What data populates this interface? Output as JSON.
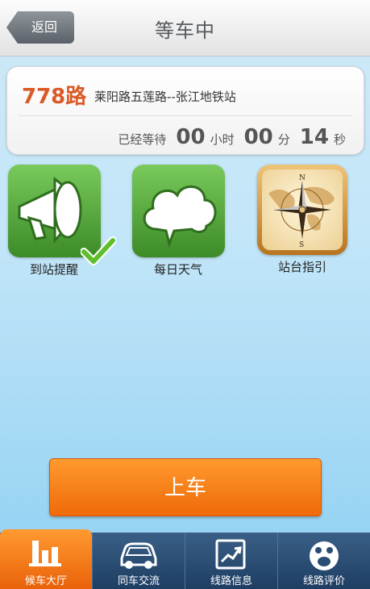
{
  "header": {
    "back_label": "返回",
    "title": "等车中"
  },
  "route": {
    "number": "778路",
    "description": "莱阳路五莲路--张江地铁站"
  },
  "wait": {
    "prefix": "已经等待",
    "hours": "00",
    "hours_unit": "小时",
    "minutes": "00",
    "minutes_unit": "分",
    "seconds": "14",
    "seconds_unit": "秒"
  },
  "features": [
    {
      "label": "到站提醒",
      "icon": "megaphone-icon"
    },
    {
      "label": "每日天气",
      "icon": "cloud-icon"
    },
    {
      "label": "站台指引",
      "icon": "compass-icon"
    }
  ],
  "board_button": "上车",
  "tabs": [
    {
      "label": "候车大厅",
      "icon": "bar-chart-icon"
    },
    {
      "label": "同车交流",
      "icon": "car-icon"
    },
    {
      "label": "线路信息",
      "icon": "trend-chart-icon"
    },
    {
      "label": "线路评价",
      "icon": "smiley-icon"
    }
  ],
  "colors": {
    "accent": "#f07a14",
    "route_number": "#d95a26",
    "tile_green": "#4ea33a",
    "tabbar": "#2a4d74"
  }
}
